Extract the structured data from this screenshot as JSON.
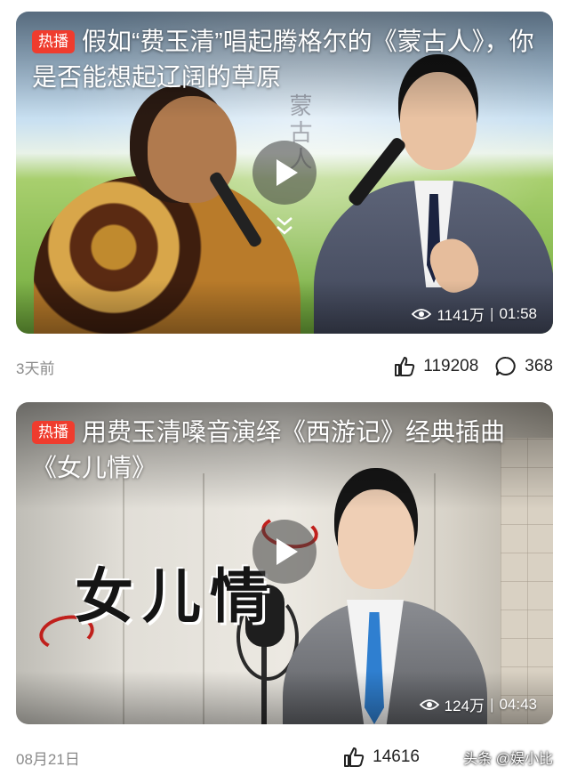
{
  "feed": {
    "items": [
      {
        "badge": "热播",
        "title": "假如“费玉清”唱起腾格尔的《蒙古人》，你是否能想起辽阔的草原",
        "overlay_art_text": "蒙古人",
        "views": "1141万",
        "duration": "01:58",
        "date": "3天前",
        "likes": "119208",
        "comments": "368"
      },
      {
        "badge": "热播",
        "title": "用费玉清嗓音演绎《西游记》经典插曲《女儿情》",
        "overlay_art_text": "女儿情",
        "views": "124万",
        "duration": "04:43",
        "date": "08月21日",
        "likes": "14616"
      }
    ]
  },
  "watermark": "头条 @娱小比",
  "icons": {
    "play": "play-icon",
    "views": "eye-icon",
    "likes": "thumbs-up-icon",
    "comments": "comment-bubble-icon",
    "expand": "chevron-double-down-icon"
  },
  "colors": {
    "badge": "#ef3c2e",
    "date_text": "#8a8a8a"
  }
}
